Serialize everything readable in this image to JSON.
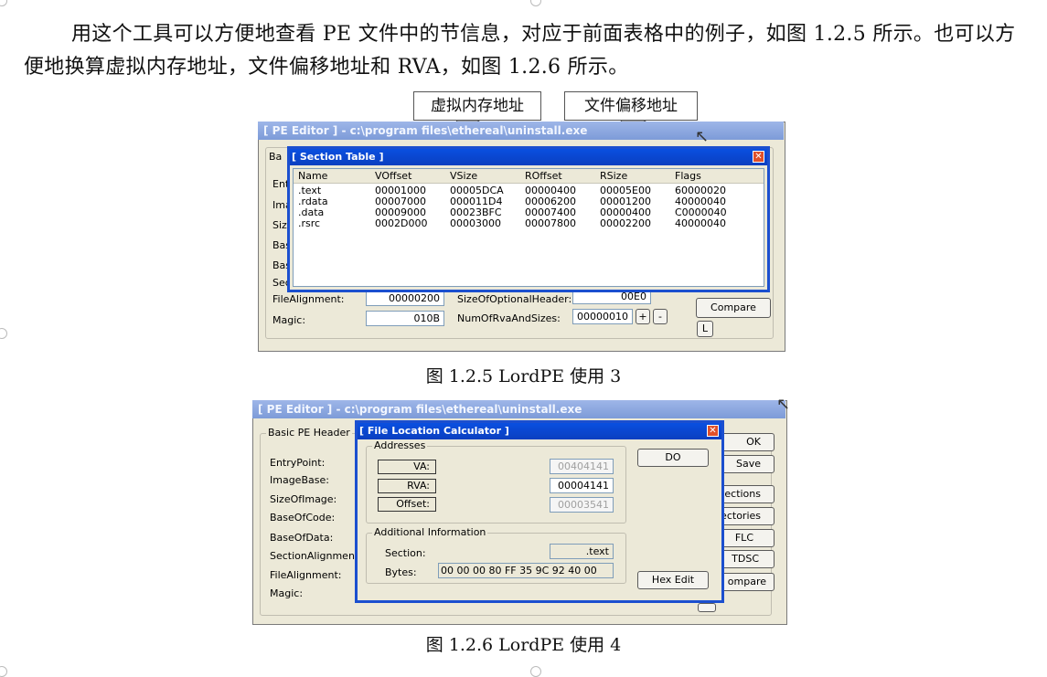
{
  "paragraph": "用这个工具可以方便地查看 PE 文件中的节信息，对应于前面表格中的例子，如图 1.2.5 所示。也可以方便地换算虚拟内存地址，文件偏移地址和 RVA，如图 1.2.6 所示。",
  "figure1": {
    "caption": "图 1.2.5  LordPE   使用 3",
    "callouts": [
      "虚拟内存地址",
      "文件偏移地址"
    ],
    "outer_title": "[ PE Editor ] - c:\\program files\\ethereal\\uninstall.exe",
    "inner_title": "[ Section Table ]",
    "close_symbol": "✕",
    "columns": [
      "Name",
      "VOffset",
      "VSize",
      "ROffset",
      "RSize",
      "Flags"
    ],
    "rows": [
      [
        ".text",
        "00001000",
        "00005DCA",
        "00000400",
        "00005E00",
        "60000020"
      ],
      [
        ".rdata",
        "00007000",
        "000011D4",
        "00006200",
        "00001200",
        "40000040"
      ],
      [
        ".data",
        "00009000",
        "00023BFC",
        "00007400",
        "00000400",
        "C0000040"
      ],
      [
        ".rsrc",
        "0002D000",
        "00003000",
        "00007800",
        "00002200",
        "40000040"
      ]
    ],
    "bg_labels": [
      "Ba",
      "Ent",
      "Ima",
      "Siz",
      "Bas",
      "Bas",
      "Sec"
    ],
    "file_alignment_label": "FileAlignment:",
    "file_alignment_value": "00000200",
    "size_optional_label": "SizeOfOptionalHeader:",
    "size_optional_value": "00E0",
    "magic_label": "Magic:",
    "magic_value": "010B",
    "num_rva_label": "NumOfRvaAndSizes:",
    "num_rva_value": "00000010",
    "plus": "+",
    "minus": "-",
    "compare_label": "Compare",
    "l_label": "L"
  },
  "figure2": {
    "caption": "图 1.2.6  LordPE   使用 4",
    "outer_title": "[ PE Editor ] - c:\\program files\\ethereal\\uninstall.exe",
    "inner_title": "[ File Location Calculator ]",
    "close_symbol": "✕",
    "basic_header": "Basic PE Header",
    "bg_labels": [
      "EntryPoint:",
      "ImageBase:",
      "SizeOfImage:",
      "BaseOfCode:",
      "BaseOfData:",
      "SectionAlignment:",
      "FileAlignment:",
      "Magic:"
    ],
    "right_buttons": [
      "OK",
      "Save",
      "ections",
      "rectories",
      "FLC",
      "TDSC",
      "ompare"
    ],
    "addresses_group": "Addresses",
    "va_label": "VA:",
    "va_value": "00404141",
    "rva_label": "RVA:",
    "rva_value": "00004141",
    "offset_label": "Offset:",
    "offset_value": "00003541",
    "do_label": "DO",
    "additional_group": "Additional Information",
    "section_label": "Section:",
    "section_value": ".text",
    "bytes_label": "Bytes:",
    "bytes_value": "00 00 00 80 FF 35 9C 92 40 00",
    "hexedit_label": "Hex Edit"
  }
}
